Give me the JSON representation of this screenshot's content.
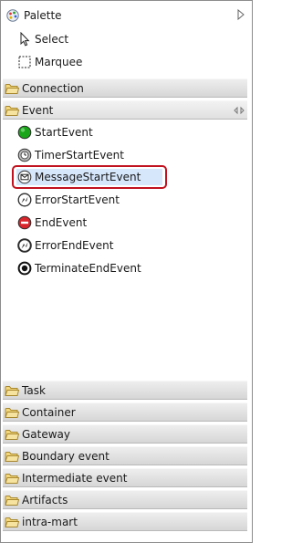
{
  "palette": {
    "title": "Palette",
    "tools": [
      {
        "label": "Select",
        "icon": "arrow-pointer-icon"
      },
      {
        "label": "Marquee",
        "icon": "marquee-icon"
      }
    ],
    "drawers_top": [
      {
        "label": "Connection",
        "state": "collapsed"
      },
      {
        "label": "Event",
        "state": "open"
      }
    ],
    "event_entries": [
      {
        "label": "StartEvent",
        "icon": "start-event-icon"
      },
      {
        "label": "TimerStartEvent",
        "icon": "timer-start-event-icon"
      },
      {
        "label": "MessageStartEvent",
        "icon": "message-start-event-icon",
        "selected": true
      },
      {
        "label": "ErrorStartEvent",
        "icon": "error-start-event-icon"
      },
      {
        "label": "EndEvent",
        "icon": "end-event-icon"
      },
      {
        "label": "ErrorEndEvent",
        "icon": "error-end-event-icon"
      },
      {
        "label": "TerminateEndEvent",
        "icon": "terminate-end-event-icon"
      }
    ],
    "drawers_bottom": [
      {
        "label": "Task"
      },
      {
        "label": "Container"
      },
      {
        "label": "Gateway"
      },
      {
        "label": "Boundary event"
      },
      {
        "label": "Intermediate event"
      },
      {
        "label": "Artifacts"
      },
      {
        "label": "intra-mart"
      }
    ],
    "colors": {
      "selection_fill": "#d6e6fb",
      "selection_outline": "#c1121f",
      "start_event": "#1aa51a",
      "end_event": "#d8262c",
      "folder": "#e8c36a"
    }
  }
}
